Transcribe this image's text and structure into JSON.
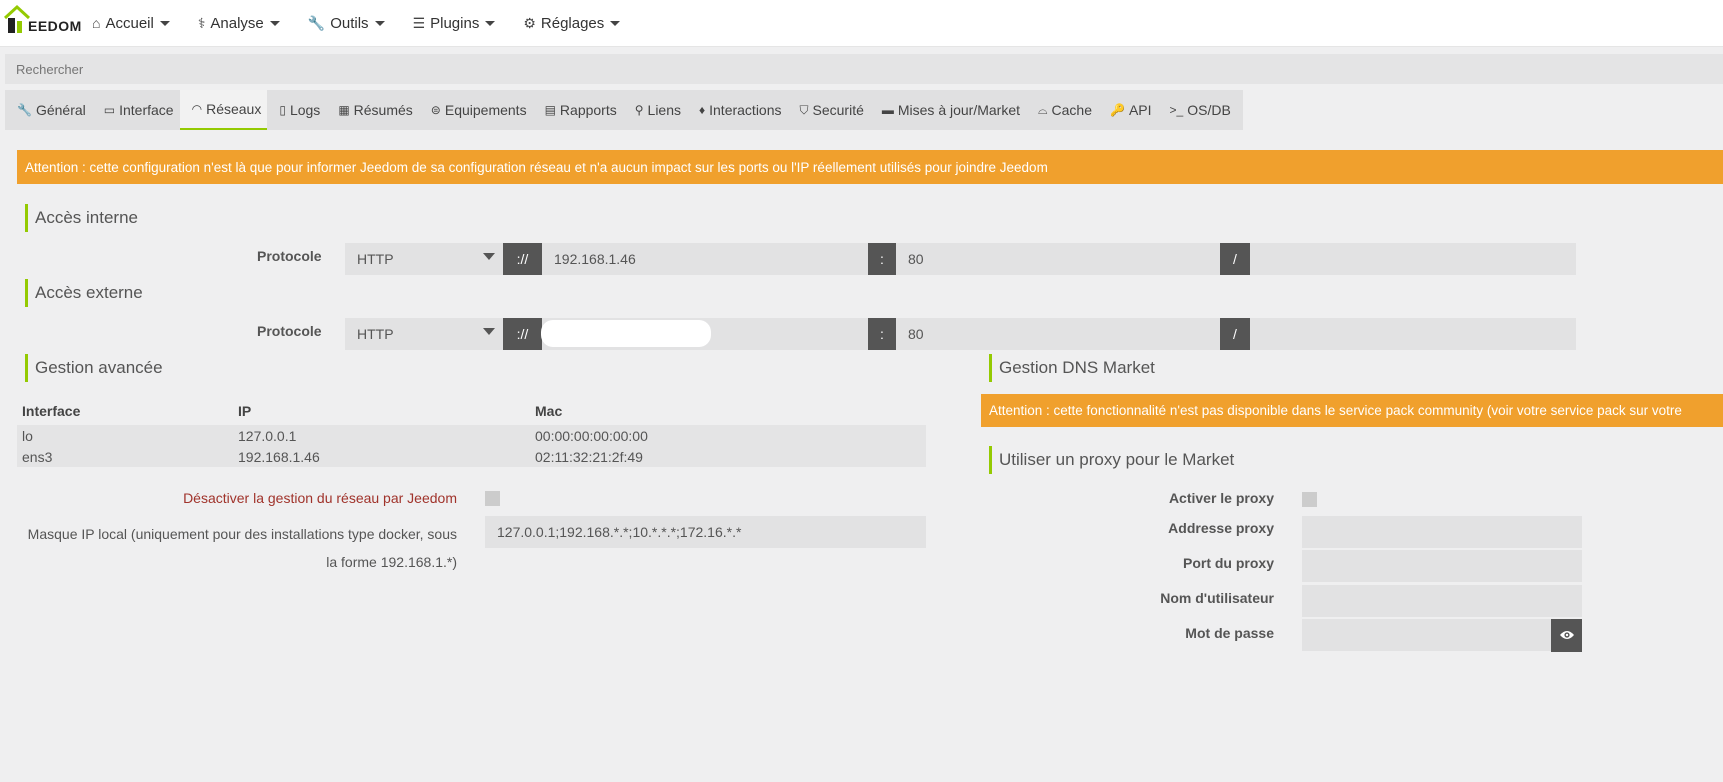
{
  "brand": {
    "text": "EEDOM"
  },
  "nav": {
    "items": [
      {
        "label": "Accueil",
        "icon": "home-icon",
        "glyph": "⌂"
      },
      {
        "label": "Analyse",
        "icon": "stethoscope-icon",
        "glyph": "⚕"
      },
      {
        "label": "Outils",
        "icon": "wrench-icon",
        "glyph": "🔧"
      },
      {
        "label": "Plugins",
        "icon": "tasks-icon",
        "glyph": "☰"
      },
      {
        "label": "Réglages",
        "icon": "gear-icon",
        "glyph": "⚙"
      }
    ]
  },
  "search": {
    "placeholder": "Rechercher"
  },
  "tabs": [
    {
      "label": "Général",
      "icon": "wrench-icon",
      "glyph": "🔧"
    },
    {
      "label": "Interface",
      "icon": "laptop-icon",
      "glyph": "▭"
    },
    {
      "label": "Réseaux",
      "icon": "rss-icon",
      "glyph": "◠"
    },
    {
      "label": "Logs",
      "icon": "file-icon",
      "glyph": "▯"
    },
    {
      "label": "Résumés",
      "icon": "table-icon",
      "glyph": "▦"
    },
    {
      "label": "Equipements",
      "icon": "cubes-icon",
      "glyph": "⊜"
    },
    {
      "label": "Rapports",
      "icon": "newspaper-icon",
      "glyph": "▤"
    },
    {
      "label": "Liens",
      "icon": "sitemap-icon",
      "glyph": "⚲"
    },
    {
      "label": "Interactions",
      "icon": "microphone-icon",
      "glyph": "♦"
    },
    {
      "label": "Securité",
      "icon": "shield-icon",
      "glyph": "⛉"
    },
    {
      "label": "Mises à jour/Market",
      "icon": "credit-card-icon",
      "glyph": "▬"
    },
    {
      "label": "Cache",
      "icon": "hdd-icon",
      "glyph": "⌓"
    },
    {
      "label": "API",
      "icon": "key-icon",
      "glyph": "🔑"
    },
    {
      "label": "OS/DB",
      "icon": "terminal-icon",
      "glyph": ">_"
    }
  ],
  "alert_main": "Attention : cette configuration n'est là que pour informer Jeedom de sa configuration réseau et n'a aucun impact sur les ports ou l'IP réellement utilisés pour joindre Jeedom",
  "internal": {
    "title": "Accès interne",
    "protocol_label": "Protocole",
    "protocol": "HTTP",
    "sep1": "://",
    "address": "192.168.1.46",
    "sep2": ":",
    "port": "80",
    "sep3": "/",
    "path": ""
  },
  "external": {
    "title": "Accès externe",
    "protocol_label": "Protocole",
    "protocol": "HTTP",
    "sep1": "://",
    "address": "",
    "sep2": ":",
    "port": "80",
    "sep3": "/",
    "path": ""
  },
  "advanced": {
    "title": "Gestion avancée",
    "columns": [
      "Interface",
      "IP",
      "Mac"
    ],
    "rows": [
      [
        "lo",
        "127.0.0.1",
        "00:00:00:00:00:00"
      ],
      [
        "ens3",
        "192.168.1.46",
        "02:11:32:21:2f:49"
      ]
    ],
    "disable_label": "Désactiver la gestion du réseau par Jeedom",
    "mask_label_1": "Masque IP local (uniquement pour des installations type docker, sous",
    "mask_label_2": "la forme 192.168.1.*)",
    "mask_value": "127.0.0.1;192.168.*.*;10.*.*.*;172.16.*.*"
  },
  "dns": {
    "title": "Gestion DNS Market",
    "alert": "Attention : cette fonctionnalité n'est pas disponible dans le service pack community (voir votre service pack sur votre"
  },
  "proxy": {
    "title": "Utiliser un proxy pour le Market",
    "enable_label": "Activer le proxy",
    "address_label": "Addresse proxy",
    "port_label": "Port du proxy",
    "user_label": "Nom d'utilisateur",
    "password_label": "Mot de passe"
  },
  "colors": {
    "accent": "#94ca02",
    "warning": "#f0a02d",
    "addon": "#555555"
  }
}
